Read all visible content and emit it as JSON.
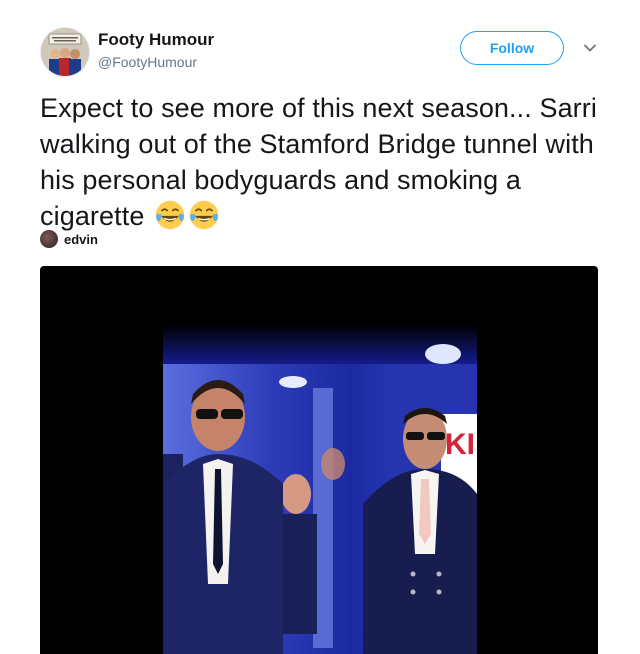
{
  "author": {
    "display_name": "Footy Humour",
    "handle": "@FootyHumour"
  },
  "follow_button": {
    "label": "Follow"
  },
  "tweet": {
    "text": "Expect to see more of this next season... Sarri walking out of the Stamford Bridge tunnel with his personal bodyguards and smoking a cigarette",
    "emojis": [
      "face-with-tears-of-joy-icon",
      "face-with-tears-of-joy-icon"
    ]
  },
  "media_tag": {
    "name": "edvin"
  },
  "colors": {
    "accent": "#1da1f2",
    "text": "#14171a",
    "secondary_text": "#657786",
    "media_background": "#000000"
  }
}
